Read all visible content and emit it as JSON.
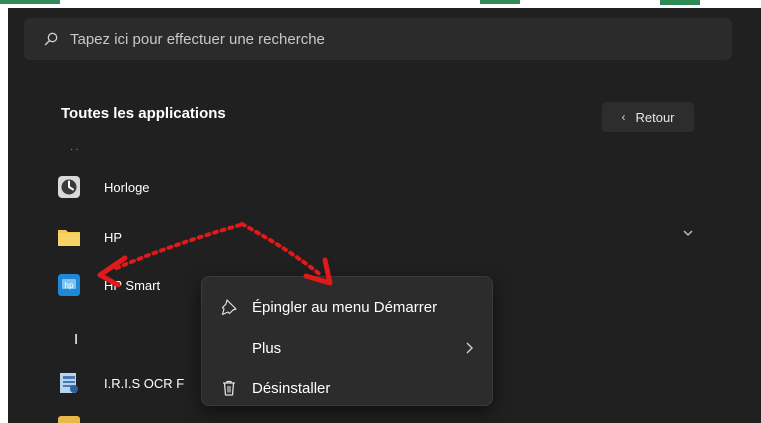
{
  "search": {
    "placeholder": "Tapez ici pour effectuer une recherche"
  },
  "all_apps": {
    "title": "Toutes les applications",
    "back_label": "Retour"
  },
  "apps": [
    {
      "label": "Horloge",
      "icon": "clock-icon"
    },
    {
      "label": "HP",
      "icon": "folder-icon"
    },
    {
      "label": "HP Smart",
      "icon": "hp-smart-icon"
    },
    {
      "label": "I.R.I.S OCR F",
      "icon": "iris-ocr-icon"
    }
  ],
  "letter_header": "I",
  "context_menu": {
    "pin_label": "Épingler au menu Démarrer",
    "more_label": "Plus",
    "uninstall_label": "Désinstaller"
  },
  "colors": {
    "panel_bg": "#202020",
    "menu_bg": "#2c2c2c",
    "annotation_red": "#e0191a"
  }
}
